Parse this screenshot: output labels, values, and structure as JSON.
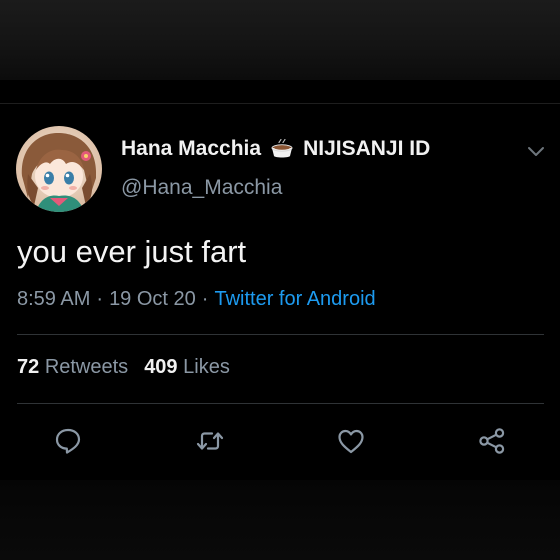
{
  "tweet": {
    "author": {
      "display_name": "Hana Macchia",
      "name_emoji_icon": "coffee-drink-icon",
      "org": "NIJISANJI ID",
      "handle": "@Hana_Macchia"
    },
    "text": "you ever just fart",
    "time": "8:59 AM",
    "separator": "·",
    "date": "19 Oct 20",
    "source": "Twitter for Android",
    "stats": {
      "retweets_count": "72",
      "retweets_label": "Retweets",
      "likes_count": "409",
      "likes_label": "Likes"
    },
    "actions": [
      "reply-icon",
      "retweet-icon",
      "like-icon",
      "share-icon"
    ]
  },
  "colors": {
    "background": "#000000",
    "link_blue": "#1d9bf0",
    "muted_text": "#8b98a5"
  }
}
